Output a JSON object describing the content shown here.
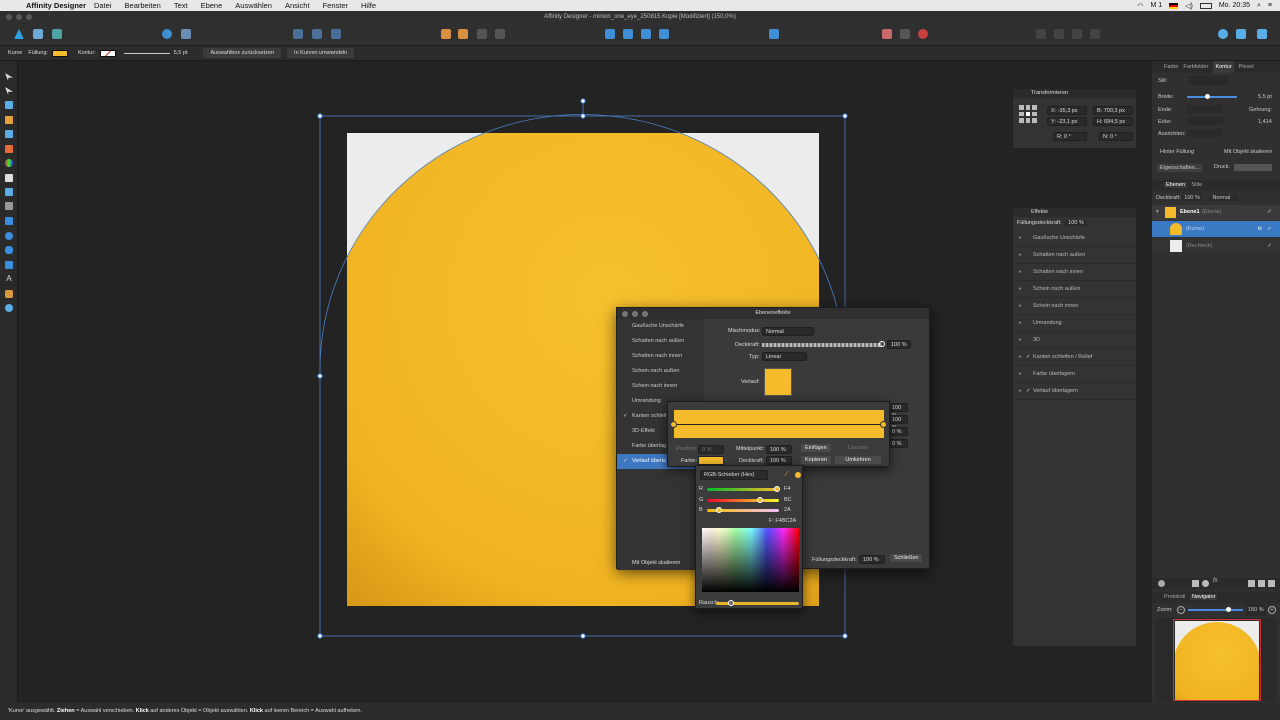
{
  "menubar": {
    "app_name": "Affinity Designer",
    "items": [
      "Datei",
      "Bearbeiten",
      "Text",
      "Ebene",
      "Auswählen",
      "Ansicht",
      "Fenster",
      "Hilfe"
    ],
    "clock": "Mo. 20:35",
    "status_m": "M 1"
  },
  "window": {
    "title": "Affinity Designer - minion_one_eye_250815 Kopie [Modifiziert] (150,0%)"
  },
  "context": {
    "tool": "Kurve",
    "fill_label": "Füllung:",
    "stroke_label": "Kontur:",
    "stroke_width": "5,5 pt",
    "reset_bbox": "Auswahlbox zurücksetzen",
    "to_curves": "In Kurven umwandeln",
    "fill_color": "#F4BC2A"
  },
  "stroke_panel": {
    "tabs": [
      "Farbe",
      "Farbfelder",
      "Kontur",
      "Pinsel"
    ],
    "style_label": "Stil:",
    "width_label": "Breite:",
    "width_value": "5,5 pt",
    "ends_label": "Ende:",
    "miter_label": "Gehrung:",
    "miter_value": "1,414",
    "corner_label": "Ecke:",
    "align_label": "Ausrichten:",
    "behind_fill": "Hinter Füllung",
    "scale_with_object": "Mit Objekt skalieren",
    "properties_btn": "Eigenschaften...",
    "pressure_label": "Druck:"
  },
  "layers_panel": {
    "tabs": [
      "Ebenen",
      "Stile"
    ],
    "opacity_label": "Deckkraft:",
    "opacity_value": "100 %",
    "blend": "Normal",
    "layers": [
      {
        "name": "Ebene1",
        "kind": "(Ebene)"
      },
      {
        "name": "(Kurve)",
        "kind": ""
      },
      {
        "name": "(Rechteck)",
        "kind": ""
      }
    ]
  },
  "transform_panel": {
    "title": "Transformieren",
    "x": "X: -35,3 px",
    "y": "Y: -23,1 px",
    "w": "B: 700,3 px",
    "h": "H: 684,5 px",
    "r": "R: 0 °",
    "s": "N: 0 °"
  },
  "effects_panel": {
    "title": "Effekte",
    "fill_opacity_label": "Füllungsdeckkraft:",
    "fill_opacity": "100 %",
    "items": [
      {
        "label": "Gaußsche Unschärfe",
        "checked": false
      },
      {
        "label": "Schatten nach außen",
        "checked": false
      },
      {
        "label": "Schatten nach innen",
        "checked": false
      },
      {
        "label": "Schein nach außen",
        "checked": false
      },
      {
        "label": "Schein nach innen",
        "checked": false
      },
      {
        "label": "Umrandung",
        "checked": false
      },
      {
        "label": "3D",
        "checked": false
      },
      {
        "label": "Kanten schleifen / Relief",
        "checked": true
      },
      {
        "label": "Farbe überlagern",
        "checked": false
      },
      {
        "label": "Verlauf überlagern",
        "checked": true
      }
    ]
  },
  "navigator": {
    "tabs": [
      "Protokoll",
      "Navigator"
    ],
    "zoom_label": "Zoom:",
    "zoom_value": "150 %"
  },
  "dialog": {
    "title": "Ebeneneffekte",
    "list": [
      {
        "label": "Gaußsche Unschärfe",
        "checked": false
      },
      {
        "label": "Schatten nach außen",
        "checked": false
      },
      {
        "label": "Schatten nach innen",
        "checked": false
      },
      {
        "label": "Schein nach außen",
        "checked": false
      },
      {
        "label": "Schein nach innen",
        "checked": false
      },
      {
        "label": "Umrandung",
        "checked": false
      },
      {
        "label": "Kanten schleif",
        "checked": true
      },
      {
        "label": "3D-Effekt",
        "checked": false
      },
      {
        "label": "Farbe überlag",
        "checked": false
      },
      {
        "label": "Verlauf überla",
        "checked": true
      }
    ],
    "blend_label": "Mischmodus:",
    "blend_value": "Normal",
    "opacity_label": "Deckkraft:",
    "opacity_value": "100 %",
    "type_label": "Typ:",
    "type_value": "Linear",
    "gradient_label": "Verlauf:",
    "right_values": [
      "100 %",
      "100 %",
      "0 %",
      "0 %"
    ],
    "position_label": "Position:",
    "position_value": "0 %",
    "midpoint_label": "Mittelpunkt:",
    "midpoint_value": "100 %",
    "insert_btn": "Einfügen",
    "delete_btn": "Löschen",
    "color_label": "Farbe:",
    "stop_opacity_label": "Deckkraft:",
    "stop_opacity_value": "100 %",
    "copy_btn": "Kopieren",
    "reverse_btn": "Umkehren",
    "scale_with_object": "Mit Objekt skalieren",
    "fill_opacity_label": "Füllungsdeckkraft:",
    "fill_opacity_value": "100 %",
    "close_btn": "Schließen"
  },
  "color_popover": {
    "mode": "RGB-Schieber (Hex)",
    "r_label": "R",
    "r_value": "F4",
    "g_label": "G",
    "g_value": "BC",
    "b_label": "B",
    "b_value": "2A",
    "hex": "F: F4BC2A",
    "noise_label": "Rausch:",
    "color": "#F4BC2A"
  },
  "status": {
    "pre": "'Kurve' ausgewählt. ",
    "k1": "Ziehen",
    "t1": " = Auswahl verschieben. ",
    "k2": "Klick",
    "t2": " auf anderes Objekt = Objekt auswählen. ",
    "k3": "Klick",
    "t3": " auf leeren Bereich = Auswahl aufheben."
  }
}
